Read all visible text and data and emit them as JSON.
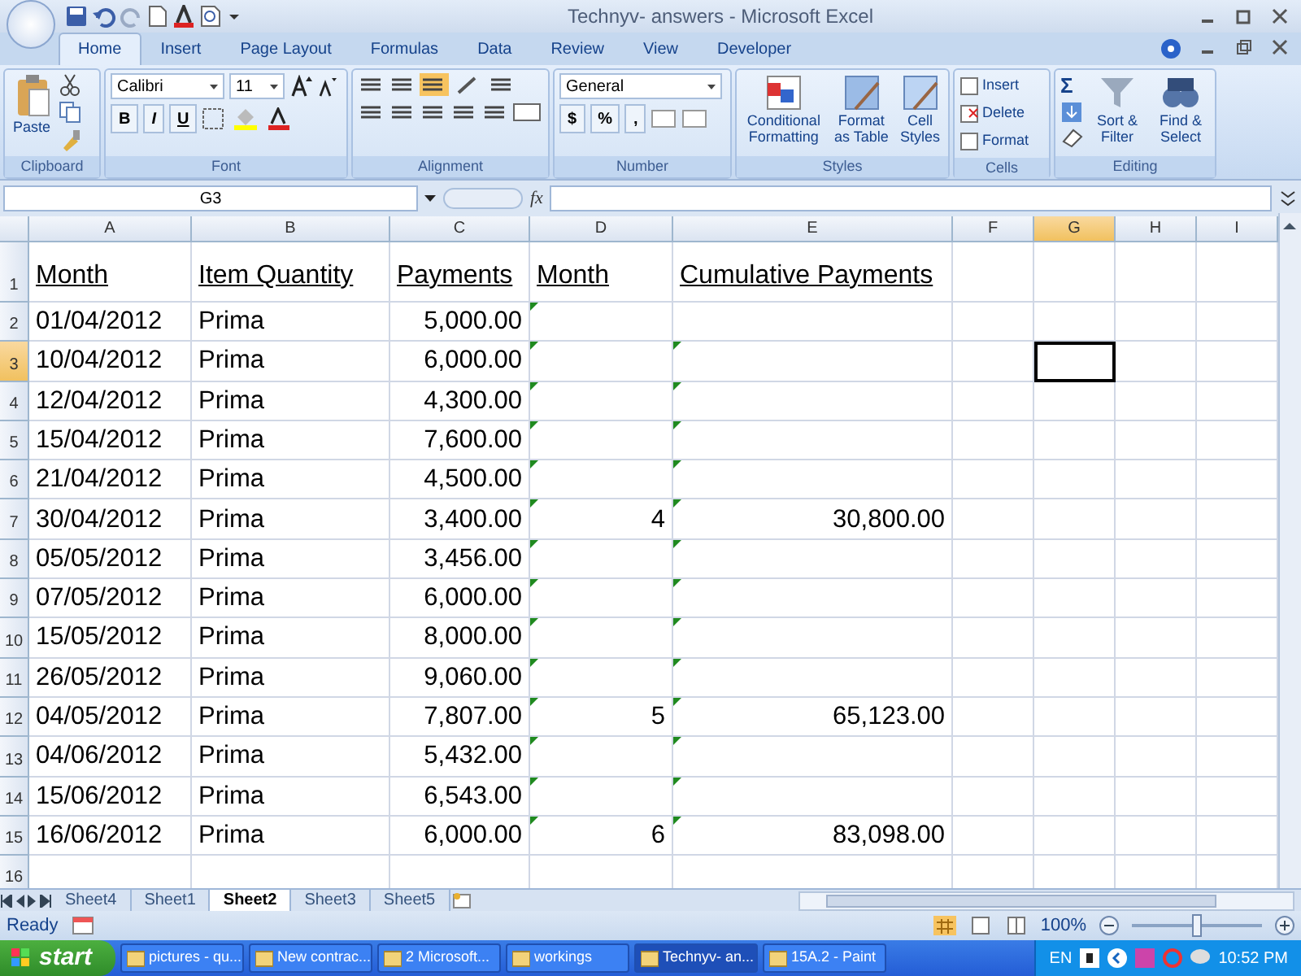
{
  "window": {
    "title": "Technyv- answers - Microsoft Excel"
  },
  "ribbon": {
    "tabs": [
      {
        "label": "Home",
        "selected": true
      },
      {
        "label": "Insert",
        "selected": false
      },
      {
        "label": "Page Layout",
        "selected": false
      },
      {
        "label": "Formulas",
        "selected": false
      },
      {
        "label": "Data",
        "selected": false
      },
      {
        "label": "Review",
        "selected": false
      },
      {
        "label": "View",
        "selected": false
      },
      {
        "label": "Developer",
        "selected": false
      }
    ],
    "clipboard": {
      "paste": "Paste",
      "label": "Clipboard"
    },
    "font": {
      "name": "Calibri",
      "size": "11",
      "buttons": [
        "B",
        "I",
        "U"
      ],
      "label": "Font"
    },
    "alignment": {
      "label": "Alignment"
    },
    "number": {
      "format": "General",
      "buttons": [
        "$",
        "%",
        ","
      ],
      "label": "Number"
    },
    "styles": {
      "buttons": [
        "Conditional Formatting",
        "Format as Table",
        "Cell Styles"
      ],
      "label": "Styles"
    },
    "cells": {
      "buttons": [
        "Insert",
        "Delete",
        "Format"
      ],
      "label": "Cells"
    },
    "editing": {
      "buttons": [
        "Sort & Filter",
        "Find & Select"
      ],
      "symbol": "Σ",
      "label": "Editing"
    }
  },
  "formula_bar": {
    "name_box": "G3",
    "fx": "fx"
  },
  "columns": [
    {
      "label": "A",
      "selected": false
    },
    {
      "label": "B",
      "selected": false
    },
    {
      "label": "C",
      "selected": false
    },
    {
      "label": "D",
      "selected": false
    },
    {
      "label": "E",
      "selected": false
    },
    {
      "label": "F",
      "selected": false
    },
    {
      "label": "G",
      "selected": true
    },
    {
      "label": "H",
      "selected": false
    },
    {
      "label": "I",
      "selected": false
    }
  ],
  "rows": [
    {
      "number": "1",
      "kind": "header",
      "selected": false,
      "cells": [
        {
          "text": "Month"
        },
        {
          "text": "Item Quantity"
        },
        {
          "text": "Payments"
        },
        {
          "text": "Month"
        },
        {
          "text": "Cumulative Payments"
        }
      ]
    },
    {
      "number": "2",
      "kind": "data",
      "selected": false,
      "cells": [
        {
          "text": "01/04/2012"
        },
        {
          "text": "Prima"
        },
        {
          "text": "5,000.00"
        },
        {
          "flagged": true
        },
        {
          "flagged": false
        }
      ]
    },
    {
      "number": "3",
      "kind": "data",
      "selected": true,
      "cells": [
        {
          "text": "10/04/2012"
        },
        {
          "text": "Prima"
        },
        {
          "text": "6,000.00"
        },
        {
          "flagged": true
        },
        {
          "flagged": true
        }
      ]
    },
    {
      "number": "4",
      "kind": "data",
      "selected": false,
      "cells": [
        {
          "text": "12/04/2012"
        },
        {
          "text": "Prima"
        },
        {
          "text": "4,300.00"
        },
        {
          "flagged": true
        },
        {
          "flagged": true
        }
      ]
    },
    {
      "number": "5",
      "kind": "data",
      "selected": false,
      "cells": [
        {
          "text": "15/04/2012"
        },
        {
          "text": "Prima"
        },
        {
          "text": "7,600.00"
        },
        {
          "flagged": true
        },
        {
          "flagged": true
        }
      ]
    },
    {
      "number": "6",
      "kind": "data",
      "selected": false,
      "cells": [
        {
          "text": "21/04/2012"
        },
        {
          "text": "Prima"
        },
        {
          "text": "4,500.00"
        },
        {
          "flagged": true
        },
        {
          "flagged": true
        }
      ]
    },
    {
      "number": "7",
      "kind": "data",
      "selected": false,
      "cells": [
        {
          "text": "30/04/2012"
        },
        {
          "text": "Prima"
        },
        {
          "text": "3,400.00"
        },
        {
          "text": "4",
          "flagged": true
        },
        {
          "text": "30,800.00",
          "flagged": true
        }
      ]
    },
    {
      "number": "8",
      "kind": "data",
      "selected": false,
      "cells": [
        {
          "text": "05/05/2012"
        },
        {
          "text": "Prima"
        },
        {
          "text": "3,456.00"
        },
        {
          "flagged": true
        },
        {
          "flagged": true
        }
      ]
    },
    {
      "number": "9",
      "kind": "data",
      "selected": false,
      "cells": [
        {
          "text": "07/05/2012"
        },
        {
          "text": "Prima"
        },
        {
          "text": "6,000.00"
        },
        {
          "flagged": true
        },
        {
          "flagged": true
        }
      ]
    },
    {
      "number": "10",
      "kind": "data",
      "selected": false,
      "cells": [
        {
          "text": "15/05/2012"
        },
        {
          "text": "Prima"
        },
        {
          "text": "8,000.00"
        },
        {
          "flagged": true
        },
        {
          "flagged": true
        }
      ]
    },
    {
      "number": "11",
      "kind": "data",
      "selected": false,
      "cells": [
        {
          "text": "26/05/2012"
        },
        {
          "text": "Prima"
        },
        {
          "text": "9,060.00"
        },
        {
          "flagged": true
        },
        {
          "flagged": true
        }
      ]
    },
    {
      "number": "12",
      "kind": "data",
      "selected": false,
      "cells": [
        {
          "text": "04/05/2012"
        },
        {
          "text": "Prima"
        },
        {
          "text": "7,807.00"
        },
        {
          "text": "5",
          "flagged": true
        },
        {
          "text": "65,123.00",
          "flagged": true
        }
      ]
    },
    {
      "number": "13",
      "kind": "data",
      "selected": false,
      "cells": [
        {
          "text": "04/06/2012"
        },
        {
          "text": "Prima"
        },
        {
          "text": "5,432.00"
        },
        {
          "flagged": true
        },
        {
          "flagged": true
        }
      ]
    },
    {
      "number": "14",
      "kind": "data",
      "selected": false,
      "cells": [
        {
          "text": "15/06/2012"
        },
        {
          "text": "Prima"
        },
        {
          "text": "6,543.00"
        },
        {
          "flagged": true
        },
        {
          "flagged": true
        }
      ]
    },
    {
      "number": "15",
      "kind": "data",
      "selected": false,
      "cells": [
        {
          "text": "16/06/2012"
        },
        {
          "text": "Prima"
        },
        {
          "text": "6,000.00"
        },
        {
          "text": "6",
          "flagged": true
        },
        {
          "text": "83,098.00",
          "flagged": true
        }
      ]
    },
    {
      "number": "16",
      "kind": "data",
      "selected": false,
      "cells": []
    }
  ],
  "sheet_tabs": [
    {
      "label": "Sheet4",
      "selected": false
    },
    {
      "label": "Sheet1",
      "selected": false
    },
    {
      "label": "Sheet2",
      "selected": true
    },
    {
      "label": "Sheet3",
      "selected": false
    },
    {
      "label": "Sheet5",
      "selected": false
    }
  ],
  "status_bar": {
    "status": "Ready",
    "zoom": "100%",
    "zoom_slider": {
      "level": 0.5
    }
  },
  "taskbar": {
    "start": "start",
    "items": [
      {
        "label": "pictures - qu...",
        "selected": false
      },
      {
        "label": "New contrac...",
        "selected": false
      },
      {
        "label": "2 Microsoft...",
        "selected": false
      },
      {
        "label": "workings",
        "selected": false
      },
      {
        "label": "Technyv- an...",
        "selected": true
      },
      {
        "label": "15A.2 - Paint",
        "selected": false
      }
    ],
    "language": "EN",
    "clock": "10:52 PM"
  }
}
